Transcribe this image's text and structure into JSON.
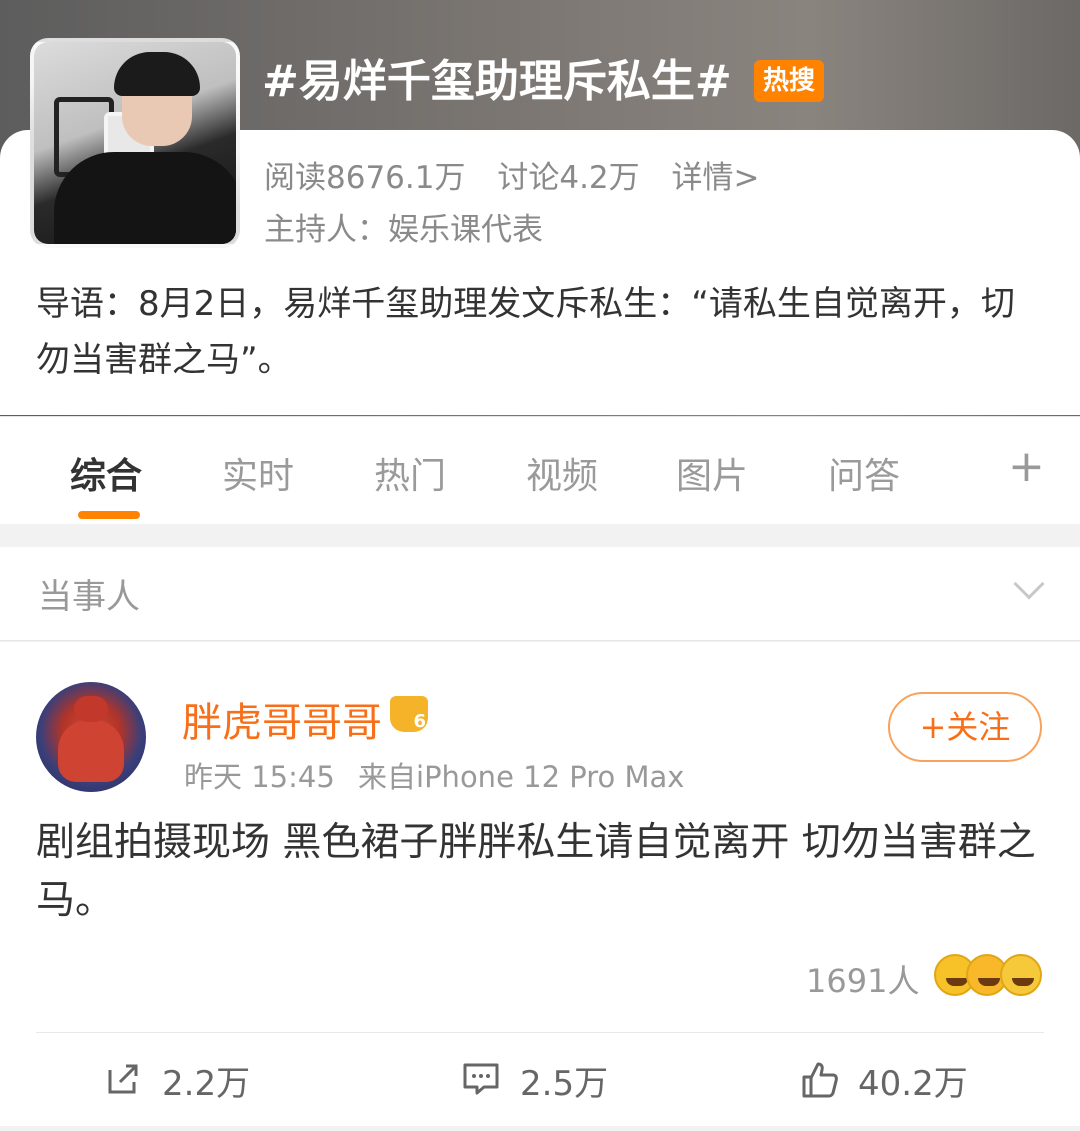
{
  "topic": {
    "title": "#易烊千玺助理斥私生#",
    "badge": "热搜",
    "read": "阅读8676.1万",
    "discuss": "讨论4.2万",
    "detail": "详情>",
    "host": "主持人：娱乐课代表",
    "intro": "导语：8月2日，易烊千玺助理发文斥私生：“请私生自觉离开，切勿当害群之马”。"
  },
  "tabs": [
    {
      "label": "综合"
    },
    {
      "label": "实时"
    },
    {
      "label": "热门"
    },
    {
      "label": "视频"
    },
    {
      "label": "图片"
    },
    {
      "label": "问答"
    }
  ],
  "tab_plus": "+",
  "section": {
    "label": "当事人"
  },
  "post": {
    "username": "胖虎哥哥哥",
    "time": "昨天 15:45",
    "source": "来自iPhone 12 Pro Max",
    "follow_label": "+关注",
    "text": "剧组拍摄现场 黑色裙子胖胖私生请自觉离开 切勿当害群之马。",
    "reactions_count": "1691人",
    "repost": "2.2万",
    "comment": "2.5万",
    "like": "40.2万"
  },
  "colors": {
    "accent": "#ff8200",
    "username": "#f86f19",
    "muted": "#999999"
  },
  "icons": [
    "repost-icon",
    "comment-icon",
    "like-icon",
    "chevron-down-icon",
    "plus-icon",
    "crown-icon"
  ]
}
